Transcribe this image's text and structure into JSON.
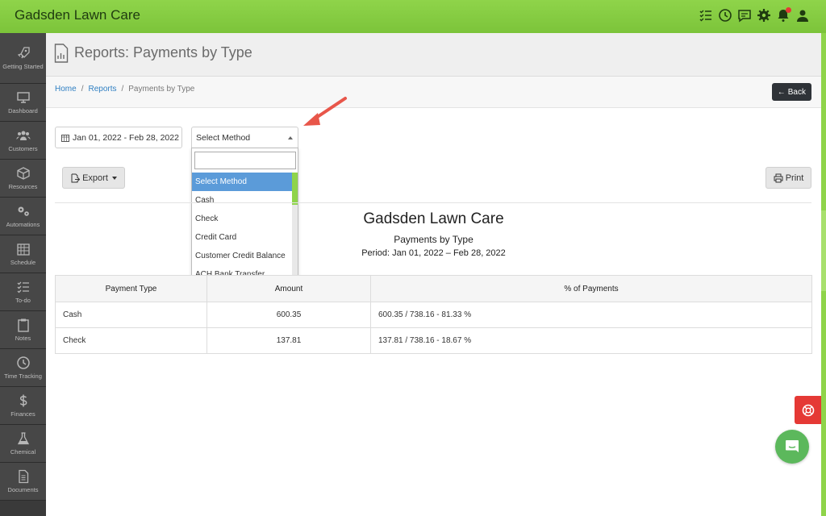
{
  "app": {
    "title": "Gadsden Lawn Care"
  },
  "topbar": {
    "icons": [
      "todo-list-icon",
      "clock-icon",
      "chat-icon",
      "gear-icon",
      "bell-icon",
      "user-icon"
    ]
  },
  "sidebar": {
    "items": [
      {
        "label": "Getting Started",
        "icon": "rocket-icon"
      },
      {
        "label": "Dashboard",
        "icon": "monitor-icon"
      },
      {
        "label": "Customers",
        "icon": "users-icon"
      },
      {
        "label": "Resources",
        "icon": "box-icon"
      },
      {
        "label": "Automations",
        "icon": "gears-icon"
      },
      {
        "label": "Schedule",
        "icon": "calendar-icon"
      },
      {
        "label": "To-do",
        "icon": "checklist-icon"
      },
      {
        "label": "Notes",
        "icon": "clipboard-icon"
      },
      {
        "label": "Time Tracking",
        "icon": "clock-icon"
      },
      {
        "label": "Finances",
        "icon": "dollar-icon"
      },
      {
        "label": "Chemical",
        "icon": "flask-icon"
      },
      {
        "label": "Documents",
        "icon": "document-icon"
      }
    ]
  },
  "header": {
    "title": "Reports: Payments by Type"
  },
  "breadcrumb": {
    "home": "Home",
    "reports": "Reports",
    "current": "Payments by Type",
    "separator": "/"
  },
  "back_button": {
    "label": "Back"
  },
  "filters": {
    "date_range": "Jan 01, 2022 - Feb 28, 2022",
    "method_selected": "Select Method",
    "method_options": [
      "Select Method",
      "Cash",
      "Check",
      "Credit Card",
      "Customer Credit Balance",
      "ACH Bank Transfer"
    ]
  },
  "actions": {
    "export_label": "Export",
    "print_label": "Print"
  },
  "report": {
    "company": "Gadsden Lawn Care",
    "subtitle": "Payments by Type",
    "period": "Period: Jan 01, 2022 – Feb 28, 2022",
    "columns": [
      "Payment Type",
      "Amount",
      "% of Payments"
    ],
    "rows": [
      {
        "type": "Cash",
        "amount": "600.35",
        "percent": "600.35 / 738.16 - 81.33 %"
      },
      {
        "type": "Check",
        "amount": "137.81",
        "percent": "137.81 / 738.16 - 18.67 %"
      }
    ]
  },
  "colors": {
    "brand_green": "#8fd44a",
    "sidebar_bg": "#474747",
    "link_blue": "#2f7fc2",
    "selected_blue": "#5b9bd9",
    "help_red": "#e53935",
    "chat_green": "#5cb85c",
    "arrow_red": "#e8564a"
  }
}
